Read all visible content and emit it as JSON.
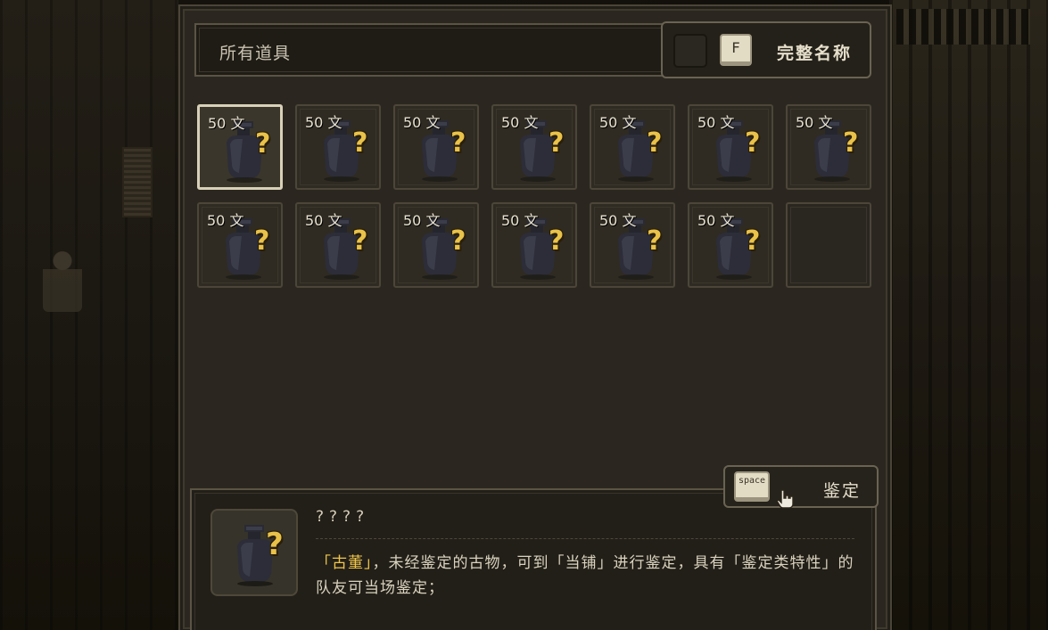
{
  "filter": {
    "label": "所有道具"
  },
  "fullname_toggle": {
    "checked": false,
    "key": "F",
    "label": "完整名称"
  },
  "items": [
    {
      "price": "50 文",
      "unknown_mark": "?",
      "selected": true
    },
    {
      "price": "50 文",
      "unknown_mark": "?"
    },
    {
      "price": "50 文",
      "unknown_mark": "?"
    },
    {
      "price": "50 文",
      "unknown_mark": "?"
    },
    {
      "price": "50 文",
      "unknown_mark": "?"
    },
    {
      "price": "50 文",
      "unknown_mark": "?"
    },
    {
      "price": "50 文",
      "unknown_mark": "?"
    },
    {
      "price": "50 文",
      "unknown_mark": "?"
    },
    {
      "price": "50 文",
      "unknown_mark": "?"
    },
    {
      "price": "50 文",
      "unknown_mark": "?"
    },
    {
      "price": "50 文",
      "unknown_mark": "?"
    },
    {
      "price": "50 文",
      "unknown_mark": "?"
    },
    {
      "price": "50 文",
      "unknown_mark": "?"
    },
    {
      "empty": true
    }
  ],
  "action": {
    "key": "space",
    "label": "鉴定",
    "icon": "pointing-hand-icon"
  },
  "detail": {
    "title": "????",
    "desc_highlight_1": "「古董」",
    "desc_part_1": "，未经鉴定的古物，可到「当铺」进行鉴定，具有「鉴定类特性」的队友可当场鉴定；",
    "icon_unknown_mark": "?"
  },
  "colors": {
    "highlight": "#f0c64a",
    "question_mark": "#e9c24a",
    "text": "#d9d2bd"
  }
}
